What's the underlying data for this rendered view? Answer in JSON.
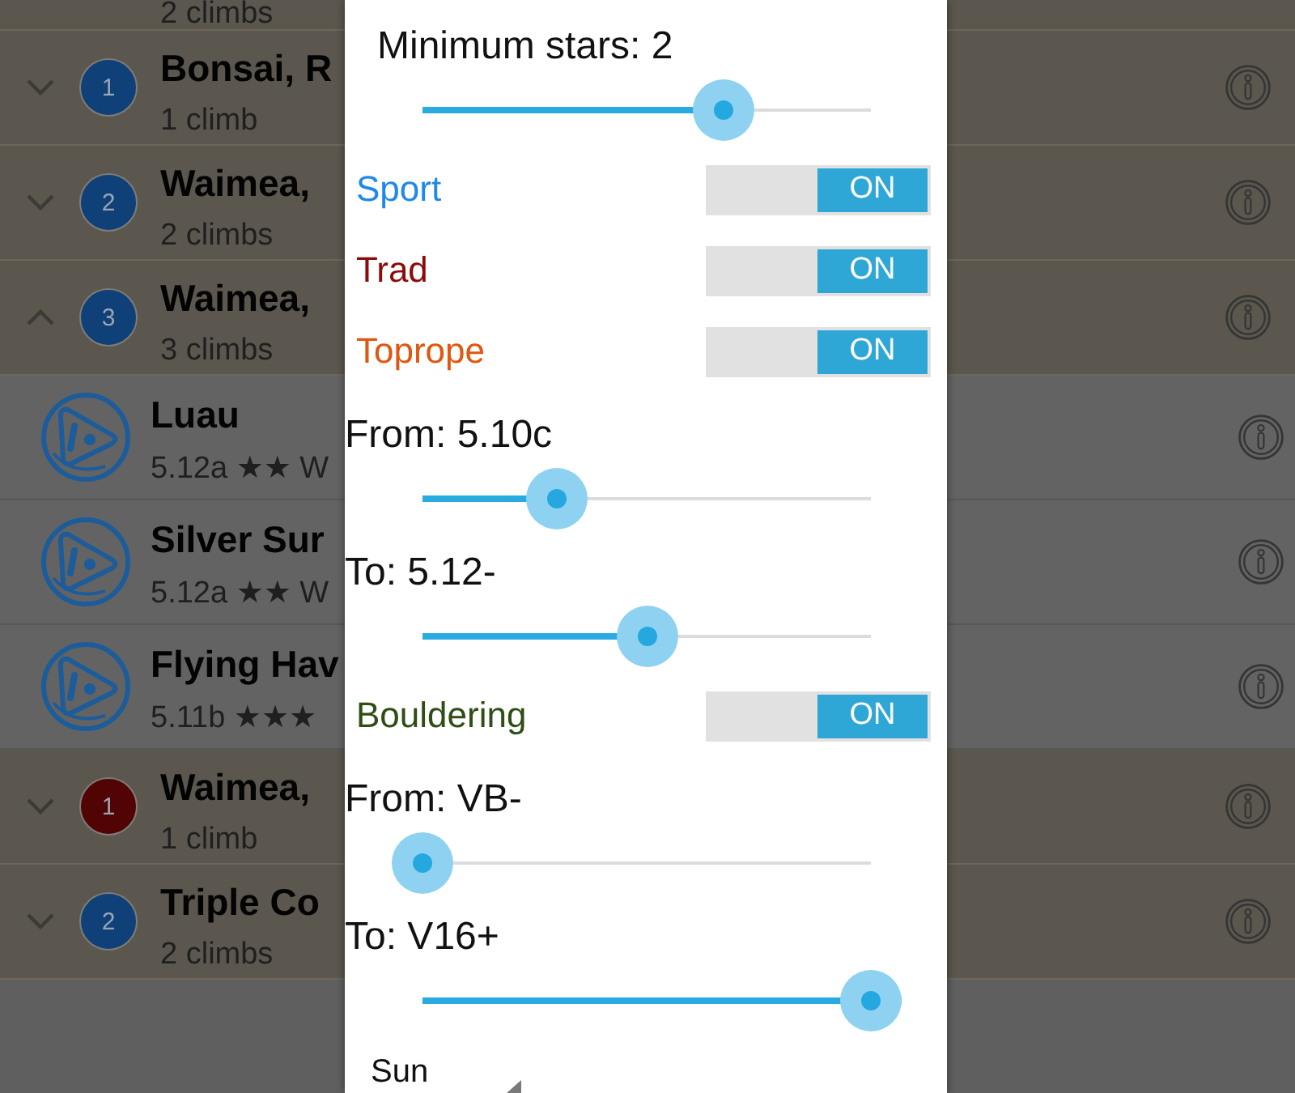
{
  "list": {
    "cut_group": {
      "subtitle": "2 climbs"
    },
    "groups": [
      {
        "expanded": false,
        "count": "1",
        "color": "#0f4178",
        "title": "Bonsai, R",
        "subtitle": "1 climb"
      },
      {
        "expanded": false,
        "count": "2",
        "color": "#0f4178",
        "title": "Waimea,",
        "subtitle": "2 climbs"
      },
      {
        "expanded": true,
        "count": "3",
        "color": "#0f4178",
        "title": "Waimea,",
        "subtitle": "3 climbs",
        "children": [
          {
            "title": "Luau",
            "subtitle": "5.12a ★★ W"
          },
          {
            "title": "Silver Sur",
            "subtitle": "5.12a ★★ W"
          },
          {
            "title": "Flying Hav",
            "subtitle": "5.11b ★★★"
          }
        ]
      },
      {
        "expanded": false,
        "count": "1",
        "color": "#520404",
        "title": "Waimea,",
        "subtitle": "1 climb"
      },
      {
        "expanded": false,
        "count": "2",
        "color": "#0f4178",
        "title": "Triple Co",
        "subtitle": "2 climbs"
      }
    ]
  },
  "dialog": {
    "min_stars": {
      "label": "Minimum stars: 2",
      "level": 0.67
    },
    "sections": [
      {
        "toggles": [
          {
            "label": "Sport",
            "color": "#1f88e8",
            "on": true,
            "state_label": "ON"
          },
          {
            "label": "Trad",
            "color": "#8b0a0a",
            "on": true,
            "state_label": "ON"
          },
          {
            "label": "Toprope",
            "color": "#e0570f",
            "on": true,
            "state_label": "ON"
          }
        ],
        "range": [
          {
            "label": "From: 5.10c",
            "level": 0.3
          },
          {
            "label": "To: 5.12-",
            "level": 0.5
          }
        ]
      },
      {
        "toggles": [
          {
            "label": "Bouldering",
            "color": "#2f4d14",
            "on": true,
            "state_label": "ON"
          }
        ],
        "range": [
          {
            "label": "From: VB-",
            "level": 0
          },
          {
            "label": "To: V16+",
            "level": 1
          }
        ]
      }
    ],
    "day_dropdown": {
      "value": "Sun"
    }
  }
}
